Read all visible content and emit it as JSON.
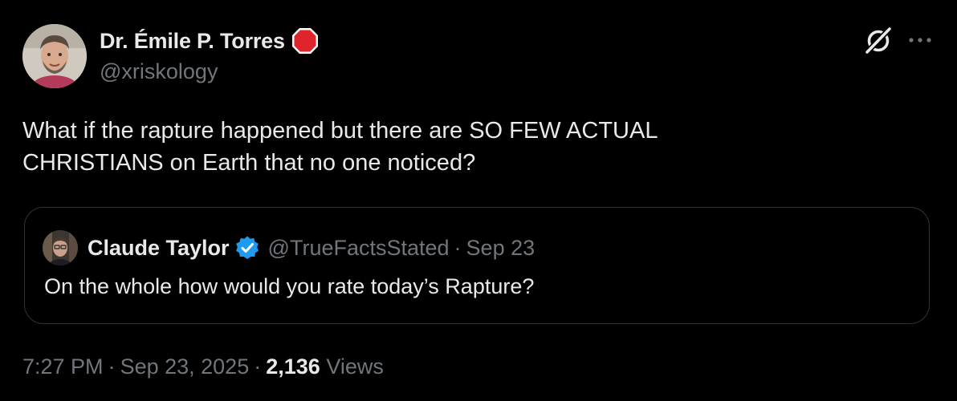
{
  "tweet": {
    "author": {
      "display_name": "Dr. Émile P. Torres",
      "handle": "@xriskology",
      "avatar_icon": "avatar-photo",
      "badge_icon": "stop-sign-icon"
    },
    "text": "What if the rapture happened but there are SO FEW ACTUAL\nCHRISTIANS on Earth that no one noticed?",
    "time": "7:27 PM",
    "date": "Sep 23, 2025",
    "views_count": "2,136",
    "views_label": "Views",
    "separator": "·"
  },
  "quoted_tweet": {
    "author_name": "Claude Taylor",
    "handle": "@TrueFactsStated",
    "separator": "·",
    "date": "Sep 23",
    "text": "On the whole how would you rate today’s Rapture?",
    "verified_icon": "verified-badge-icon"
  },
  "actions": {
    "grok_icon": "grok-icon",
    "more_icon": "more-options-icon"
  },
  "colors": {
    "background": "#000000",
    "primary_text": "#e7e9ea",
    "secondary_text": "#71767b",
    "border": "#2f3336",
    "verified_blue": "#1d9bf0",
    "stop_red": "#e0242b"
  }
}
